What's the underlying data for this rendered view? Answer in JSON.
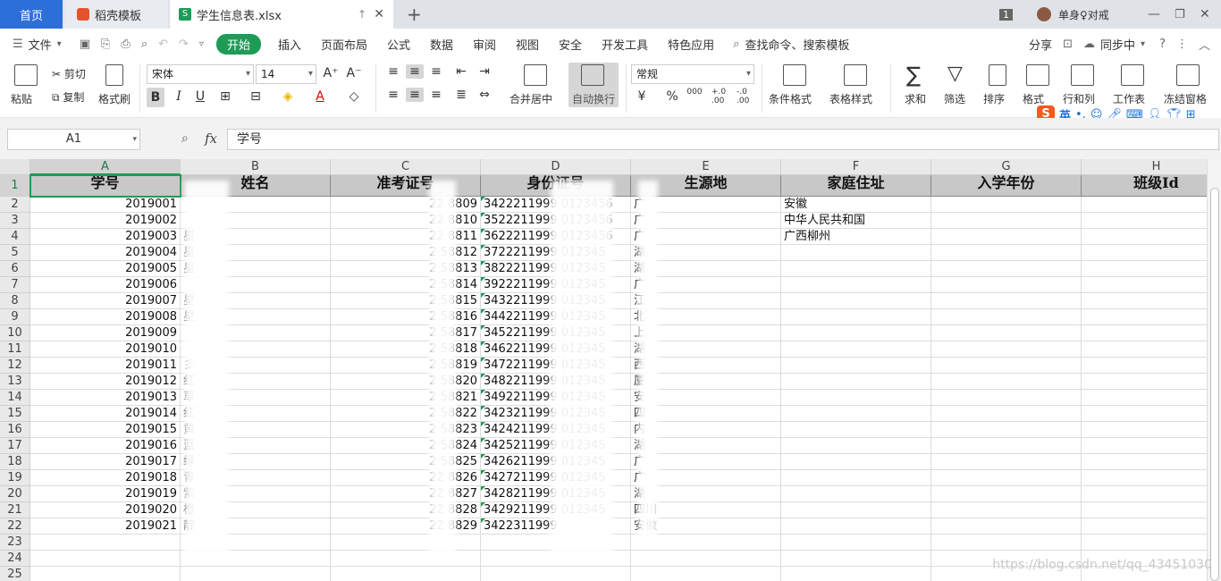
{
  "tabs": {
    "home": "首页",
    "docer": "稻壳模板",
    "file": "学生信息表.xlsx"
  },
  "titlebar": {
    "badge": "1",
    "user": "单身♀对戒"
  },
  "menu": {
    "file": "文件",
    "items": [
      "开始",
      "插入",
      "页面布局",
      "公式",
      "数据",
      "审阅",
      "视图",
      "安全",
      "开发工具",
      "特色应用"
    ],
    "search": "查找命令、搜索模板",
    "share": "分享",
    "sync": "同步中"
  },
  "ribbon": {
    "paste": "粘贴",
    "cut": "剪切",
    "copy": "复制",
    "format_painter": "格式刷",
    "font_name": "宋体",
    "font_size": "14",
    "bold": "B",
    "italic": "I",
    "underline": "U",
    "merge_center": "合并居中",
    "wrap_text": "自动换行",
    "number_format": "常规",
    "conditional_format": "条件格式",
    "table_style": "表格样式",
    "sum": "求和",
    "filter": "筛选",
    "sort": "排序",
    "format": "格式",
    "row_col": "行和列",
    "worksheet": "工作表",
    "freeze": "冻结窗格",
    "percent": "%",
    "thousands": "000",
    "dec_inc": "+.0 .00",
    "dec_dec": "-.0 .00"
  },
  "ime": {
    "mode": "英"
  },
  "formula": {
    "name_box": "A1",
    "fx": "fx",
    "content": "学号"
  },
  "sheet": {
    "columns": [
      "A",
      "B",
      "C",
      "D",
      "E",
      "F",
      "G",
      "H"
    ],
    "row_numbers": [
      "1",
      "2",
      "3",
      "4",
      "5",
      "6",
      "7",
      "8",
      "9",
      "10",
      "11",
      "12",
      "13",
      "14",
      "15",
      "16",
      "17",
      "18",
      "19",
      "20",
      "21",
      "22",
      "23",
      "24",
      "25"
    ],
    "headers": [
      "学号",
      "姓名",
      "准考证号",
      "身份证号",
      "生源地",
      "家庭住址",
      "入学年份",
      "班级Id"
    ],
    "rows": [
      {
        "id": "2019001",
        "name": "",
        "exam": "22  8809",
        "idcard": "3422211999  0123456",
        "origin": "广",
        "address": "安徽"
      },
      {
        "id": "2019002",
        "name": "",
        "exam": "22  8810",
        "idcard": "3522211999  0123456",
        "origin": "广",
        "address": "中华人民共和国"
      },
      {
        "id": "2019003",
        "name": "星",
        "exam": "22  8811",
        "idcard": "3622211999  0123456",
        "origin": "广",
        "address": "广西柳州"
      },
      {
        "id": "2019004",
        "name": "星",
        "exam": "2  58812",
        "idcard": "3722211999  012345",
        "origin": "湖",
        "address": ""
      },
      {
        "id": "2019005",
        "name": "星",
        "exam": "2  58813",
        "idcard": "3822211999  012345",
        "origin": "湖",
        "address": ""
      },
      {
        "id": "2019006",
        "name": "",
        "exam": "2  58814",
        "idcard": "3922211999  012345",
        "origin": "广",
        "address": ""
      },
      {
        "id": "2019007",
        "name": "星",
        "exam": "2  58815",
        "idcard": "3432211999  012345",
        "origin": "江",
        "address": ""
      },
      {
        "id": "2019008",
        "name": "星",
        "exam": "2  58816",
        "idcard": "3442211999  012345",
        "origin": "北",
        "address": ""
      },
      {
        "id": "2019009",
        "name": "",
        "exam": "2  58817",
        "idcard": "3452211999  012345",
        "origin": "上",
        "address": ""
      },
      {
        "id": "2019010",
        "name": "",
        "exam": "2  58818",
        "idcard": "3462211999  012345",
        "origin": "湖",
        "address": ""
      },
      {
        "id": "2019011",
        "name": "彡",
        "exam": "2  58819",
        "idcard": "3472211999  012345",
        "origin": "西",
        "address": ""
      },
      {
        "id": "2019012",
        "name": "红",
        "exam": "2  58820",
        "idcard": "3482211999  012345",
        "origin": "厦",
        "address": ""
      },
      {
        "id": "2019013",
        "name": "草",
        "exam": "2  58821",
        "idcard": "3492211999  012345",
        "origin": "安",
        "address": ""
      },
      {
        "id": "2019014",
        "name": "红",
        "exam": "2  58822",
        "idcard": "3423211999  012345",
        "origin": "四",
        "address": ""
      },
      {
        "id": "2019015",
        "name": "黄",
        "exam": "2  58823",
        "idcard": "3424211999  012345",
        "origin": "内",
        "address": ""
      },
      {
        "id": "2019016",
        "name": "蓝",
        "exam": "2  58824",
        "idcard": "3425211999  012345",
        "origin": "湖",
        "address": ""
      },
      {
        "id": "2019017",
        "name": "绿",
        "exam": "2  58825",
        "idcard": "3426211999  012345",
        "origin": "广",
        "address": ""
      },
      {
        "id": "2019018",
        "name": "青",
        "exam": "22  8826",
        "idcard": "3427211999  012345",
        "origin": "广",
        "address": ""
      },
      {
        "id": "2019019",
        "name": "紫",
        "exam": "22  8827",
        "idcard": "3428211999  012345",
        "origin": "湖",
        "address": ""
      },
      {
        "id": "2019020",
        "name": "橙",
        "exam": "22  8828",
        "idcard": "3429211999  012345",
        "origin": "四川",
        "address": ""
      },
      {
        "id": "2019021",
        "name": "靛",
        "exam": "22  8829",
        "idcard": "3422311999",
        "origin": "安徽",
        "address": ""
      }
    ]
  },
  "watermark": "https://blog.csdn.net/qq_43451030",
  "colors": {
    "accent": "#1e9b57",
    "tab_home": "#2c6fd9",
    "header_fill": "#c8c8c8"
  }
}
